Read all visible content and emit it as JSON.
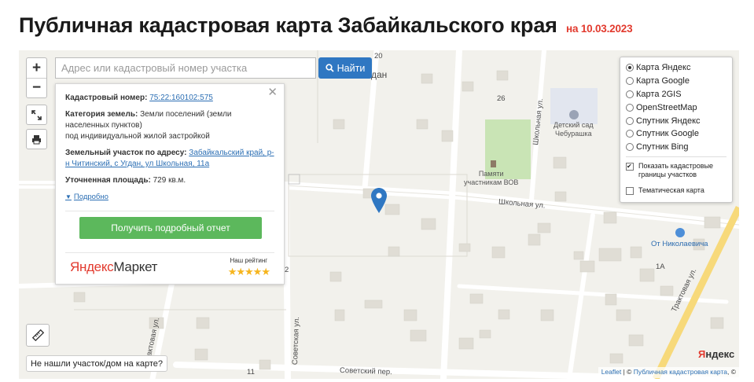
{
  "header": {
    "title": "Публичная кадастровая карта Забайкальского края",
    "date": "на 10.03.2023"
  },
  "colors": {
    "title_date": "#e23a2e",
    "search_button": "#2f77c2",
    "report_button": "#5cb85c",
    "link": "#2c6fb4",
    "map_bg": "#f2f1ec",
    "pin": "#2f77c2",
    "park": "#c9e4b5",
    "main_road": "#f7d97a"
  },
  "controls": {
    "zoom_in": "+",
    "zoom_out": "−",
    "fullscreen_icon": "expand-icon",
    "print_icon": "printer-icon",
    "ruler_icon": "ruler-icon"
  },
  "search": {
    "placeholder": "Адрес или кадастровый номер участка",
    "button_label": "Найти",
    "button_icon": "search-icon"
  },
  "info_card": {
    "cadastral_label": "Кадастровый номер:",
    "cadastral_value": "75:22:160102:575",
    "category_label": "Категория земель:",
    "category_value": "Земли поселений (земли населенных пунктов)",
    "usage": "под индивидуальной жилой застройкой",
    "address_label": "Земельный участок по адресу:",
    "address_value": "Забайкальский край, р-н Читинский, с Угдан, ул Школьная, 11а",
    "area_label": "Уточненная площадь:",
    "area_value": "729 кв.м.",
    "more_label": "Подробно",
    "report_button": "Получить подробный отчет",
    "ad_brand_1": "Яндекс",
    "ad_brand_2": "Маркет",
    "rating_label": "Наш рейтинг",
    "rating_stars": 5,
    "stars_text": "★★★★★"
  },
  "layers": {
    "options": [
      {
        "label": "Карта Яндекс",
        "selected": true
      },
      {
        "label": "Карта Google",
        "selected": false
      },
      {
        "label": "Карта 2GIS",
        "selected": false
      },
      {
        "label": "OpenStreetMap",
        "selected": false
      },
      {
        "label": "Спутник Яндекс",
        "selected": false
      },
      {
        "label": "Спутник Google",
        "selected": false
      },
      {
        "label": "Спутник Bing",
        "selected": false
      }
    ],
    "show_borders_label": "Показать кадастровые границы участков",
    "show_borders_checked": true,
    "thematic_label": "Тематическая карта",
    "thematic_checked": false
  },
  "map": {
    "labels": {
      "school_street": "Школьная ул.",
      "school_street_vert": "Школьная ул.",
      "sovetskaya_vert": "Советская ул.",
      "sovetsky_lane": "Советский пер.",
      "traktovaya_left": "Трактовая ул.",
      "traktovaya_right": "Трактовая ул.",
      "kindergarten": "Детский сад\nЧебурашка",
      "memorial": "Памяти\nучастникам ВОВ",
      "cafe": "От Николаевича",
      "num_20": "20",
      "num_26": "26",
      "num_2": "2",
      "num_11": "11",
      "num_1a": "1А",
      "village_tail": "дан"
    }
  },
  "bottom": {
    "not_found": "Не нашли участок/дом на карте?",
    "yandex_1": "Я",
    "yandex_2": "ндекс",
    "attr_leaflet": "Leaflet",
    "attr_sep": " | © ",
    "attr_map": "Публичная кадастровая карта",
    "attr_tail": ", ©"
  }
}
